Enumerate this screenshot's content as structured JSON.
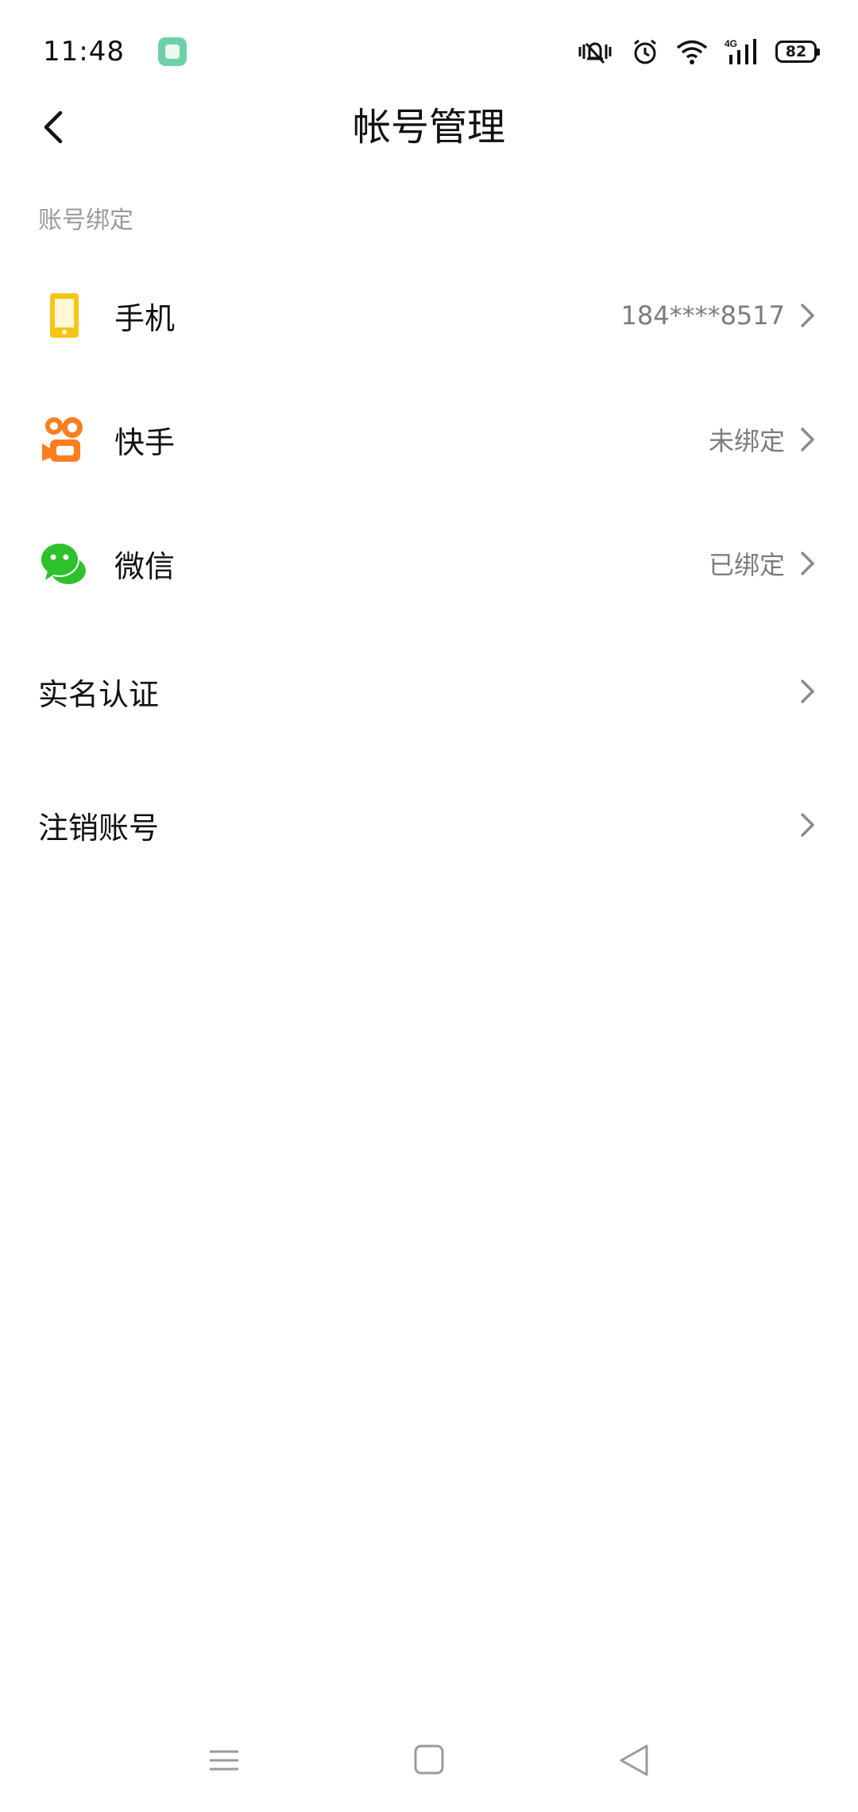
{
  "status_bar": {
    "time": "11:48",
    "battery": "82",
    "network": "4G",
    "icons": [
      "app-notification-icon",
      "vibrate-icon",
      "alarm-icon",
      "wifi-icon",
      "signal-icon",
      "battery-icon"
    ]
  },
  "header": {
    "title": "帐号管理",
    "back_icon": "back-arrow-icon"
  },
  "section": {
    "label": "账号绑定"
  },
  "bindings": [
    {
      "label": "手机",
      "value": "184****8517",
      "icon": "phone-icon",
      "color": "#f5c518"
    },
    {
      "label": "快手",
      "value": "未绑定",
      "icon": "kuaishou-icon",
      "color": "#ff7e20"
    },
    {
      "label": "微信",
      "value": "已绑定",
      "icon": "wechat-icon",
      "color": "#2dc22d"
    }
  ],
  "settings": [
    {
      "label": "实名认证"
    },
    {
      "label": "注销账号"
    }
  ],
  "system_nav": [
    "menu-icon",
    "home-icon",
    "back-icon"
  ],
  "colors": {
    "chevron": "#8a8a8a",
    "secondary_text": "#7c7c7c",
    "section_label": "#9a9a9a"
  }
}
